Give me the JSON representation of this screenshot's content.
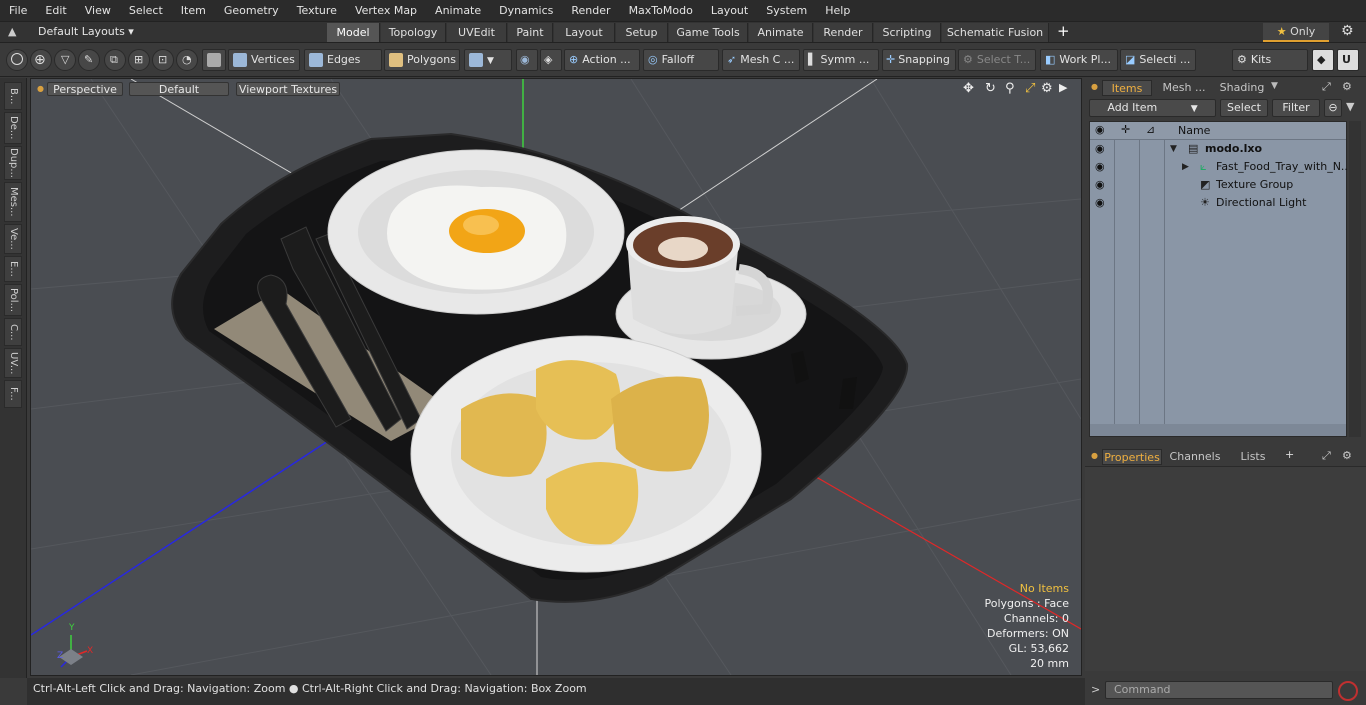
{
  "menubar": {
    "items": [
      "File",
      "Edit",
      "View",
      "Select",
      "Item",
      "Geometry",
      "Texture",
      "Vertex Map",
      "Animate",
      "Dynamics",
      "Render",
      "MaxToModo",
      "Layout",
      "System",
      "Help"
    ]
  },
  "tabbar": {
    "layouts_label": "Default Layouts ▾",
    "tabs": [
      "Model",
      "Topology",
      "UVEdit",
      "Paint",
      "Layout",
      "Setup",
      "Game Tools",
      "Animate",
      "Render",
      "Scripting",
      "Schematic Fusion"
    ],
    "active_tab": "Model",
    "add_label": "+",
    "only_label": "Only"
  },
  "toolbar": {
    "vertices": "Vertices",
    "edges": "Edges",
    "polygons": "Polygons",
    "action": "Action ...",
    "falloff": "Falloff",
    "mesh_c": "Mesh C ...",
    "symm": "Symm ...",
    "snapping": "Snapping",
    "select_t": "Select T...",
    "work_pl": "Work Pl...",
    "selecti": "Selecti ...",
    "kits": "Kits"
  },
  "leftstrip": {
    "tabs": [
      "B...",
      "De...",
      "Dup...",
      "Mes...",
      "Ve...",
      "E...",
      "Pol...",
      "C...",
      "UV...",
      "F..."
    ]
  },
  "viewport": {
    "perspective_label": "Perspective",
    "default_label": "Default",
    "textures_label": "Viewport Textures",
    "info": {
      "no_items": "No Items",
      "polygons": "Polygons : Face",
      "channels": "Channels: 0",
      "deformers": "Deformers: ON",
      "gl": "GL: 53,662",
      "scale": "20 mm"
    },
    "axis_labels": {
      "y": "Y",
      "x": "X",
      "z": "Z"
    },
    "colors": {
      "tray": "#1c1c1d",
      "plate": "#ececec",
      "nugget": "#e1b850",
      "yolk": "#f2a516",
      "coffee": "#6a3e2a",
      "grid": "#4f5257",
      "bg": "#4a4d52"
    }
  },
  "statusbar": {
    "text": "Ctrl-Alt-Left Click and Drag: Navigation: Zoom ● Ctrl-Alt-Right Click and Drag: Navigation: Box Zoom"
  },
  "rightpanel": {
    "top_tabs": [
      "Items",
      "Mesh ...",
      "Shading"
    ],
    "add_item": "Add Item",
    "select": "Select",
    "filter": "Filter",
    "column_name": "Name",
    "items": [
      {
        "label": "modo.lxo",
        "icon": "scene-icon"
      },
      {
        "label": "Fast_Food_Tray_with_N...",
        "icon": "mesh-icon"
      },
      {
        "label": "Texture Group",
        "icon": "texture-group-icon"
      },
      {
        "label": "Directional Light",
        "icon": "light-icon"
      }
    ],
    "bottom_tabs": [
      "Properties",
      "Channels",
      "Lists"
    ],
    "add_tab": "+",
    "command_placeholder": "Command",
    "prompt": ">"
  }
}
